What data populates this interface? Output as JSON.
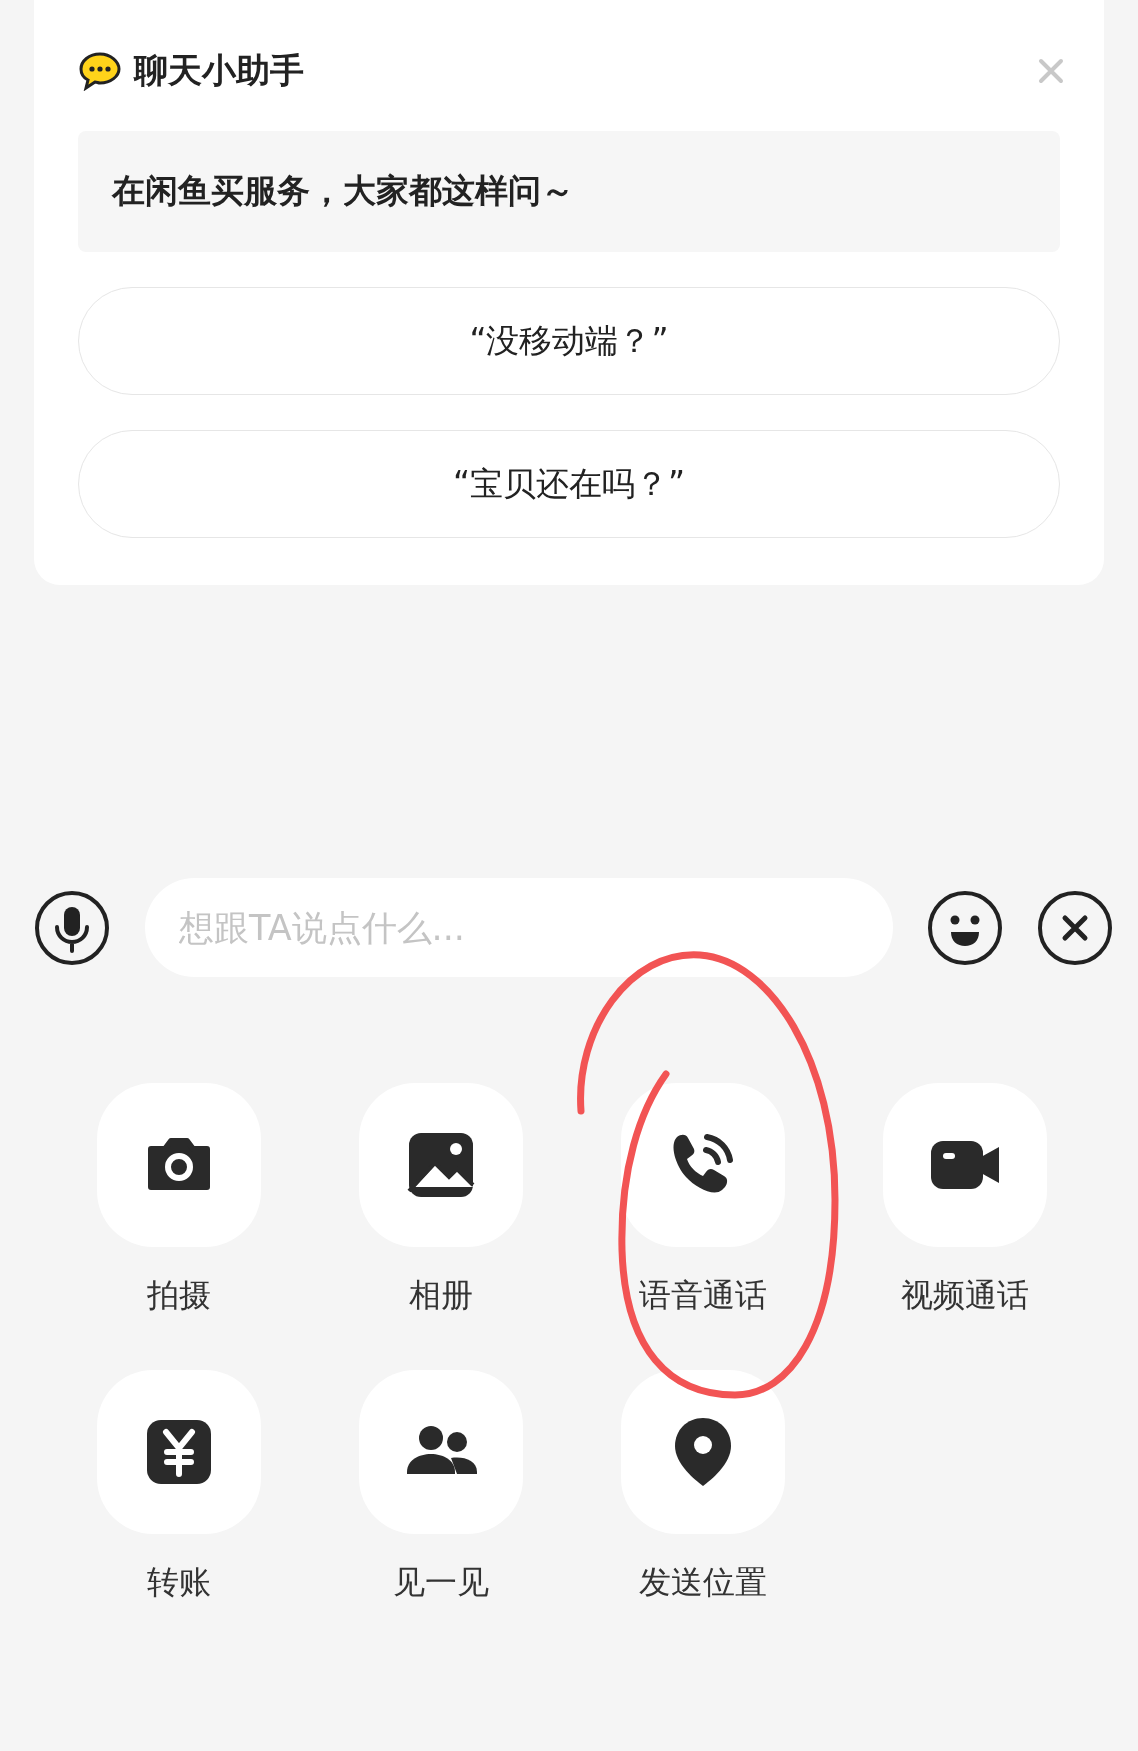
{
  "assistant": {
    "title": "聊天小助手",
    "prompt": "在闲鱼买服务，大家都这样问～",
    "suggestions": [
      "“没移动端？”",
      "“宝贝还在吗？”"
    ]
  },
  "composer": {
    "placeholder": "想跟TA说点什么..."
  },
  "actions": [
    {
      "label": "拍摄",
      "kind": "camera"
    },
    {
      "label": "相册",
      "kind": "album"
    },
    {
      "label": "语音通话",
      "kind": "voice"
    },
    {
      "label": "视频通话",
      "kind": "video"
    },
    {
      "label": "转账",
      "kind": "transfer"
    },
    {
      "label": "见一见",
      "kind": "meet"
    },
    {
      "label": "发送位置",
      "kind": "location"
    }
  ]
}
